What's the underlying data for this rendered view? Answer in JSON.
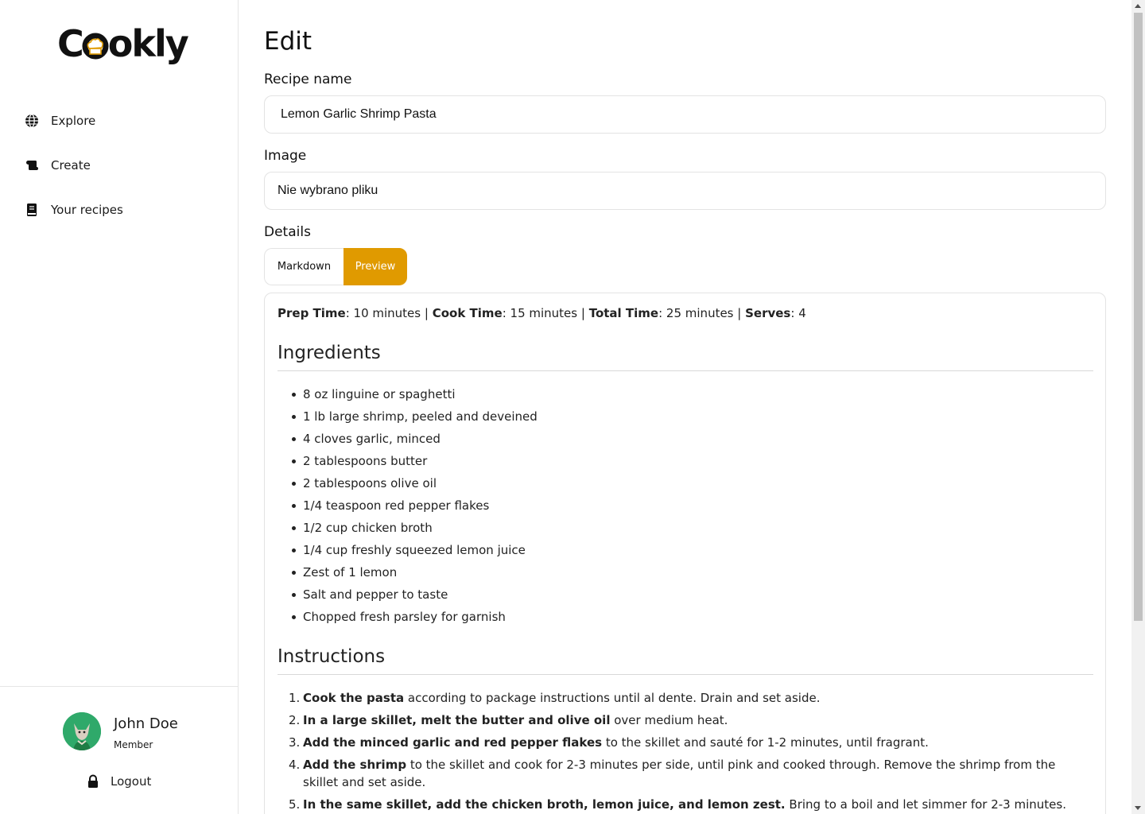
{
  "app": {
    "logo_text_left": "C",
    "logo_text_right": "okly",
    "brand_color": "#e09a00"
  },
  "sidebar": {
    "items": [
      {
        "label": "Explore",
        "icon": "globe-icon"
      },
      {
        "label": "Create",
        "icon": "scroll-icon"
      },
      {
        "label": "Your recipes",
        "icon": "book-icon"
      }
    ]
  },
  "user": {
    "name": "John Doe",
    "role": "Member",
    "logout_label": "Logout"
  },
  "page": {
    "title": "Edit",
    "recipe_name_label": "Recipe name",
    "recipe_name_value": "Lemon Garlic Shrimp Pasta",
    "image_label": "Image",
    "image_value": "Nie wybrano pliku",
    "details_label": "Details",
    "tabs": {
      "markdown": "Markdown",
      "preview": "Preview",
      "active": "Preview"
    }
  },
  "preview": {
    "meta": [
      {
        "key": "Prep Time",
        "value": "10 minutes"
      },
      {
        "key": "Cook Time",
        "value": "15 minutes"
      },
      {
        "key": "Total Time",
        "value": "25 minutes"
      },
      {
        "key": "Serves",
        "value": "4"
      }
    ],
    "ingredients_heading": "Ingredients",
    "ingredients": [
      "8 oz linguine or spaghetti",
      "1 lb large shrimp, peeled and deveined",
      "4 cloves garlic, minced",
      "2 tablespoons butter",
      "2 tablespoons olive oil",
      "1/4 teaspoon red pepper flakes",
      "1/2 cup chicken broth",
      "1/4 cup freshly squeezed lemon juice",
      "Zest of 1 lemon",
      "Salt and pepper to taste",
      "Chopped fresh parsley for garnish"
    ],
    "instructions_heading": "Instructions",
    "instructions": [
      {
        "bold": "Cook the pasta",
        "rest": " according to package instructions until al dente. Drain and set aside."
      },
      {
        "bold": "In a large skillet, melt the butter and olive oil",
        "rest": " over medium heat."
      },
      {
        "bold": "Add the minced garlic and red pepper flakes",
        "rest": " to the skillet and sauté for 1-2 minutes, until fragrant."
      },
      {
        "bold": "Add the shrimp",
        "rest": " to the skillet and cook for 2-3 minutes per side, until pink and cooked through. Remove the shrimp from the skillet and set aside."
      },
      {
        "bold": "In the same skillet, add the chicken broth, lemon juice, and lemon zest.",
        "rest": " Bring to a boil and let simmer for 2-3 minutes."
      }
    ]
  }
}
